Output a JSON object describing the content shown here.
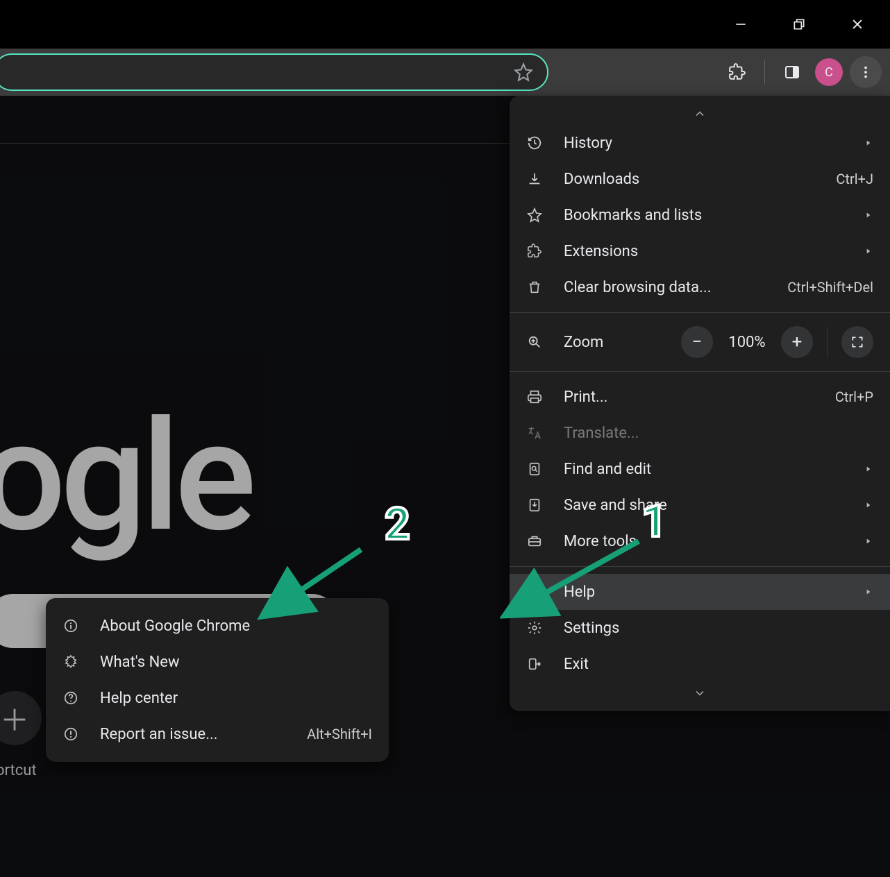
{
  "window_controls": {
    "minimize": "minimize",
    "maximize": "maximize",
    "close": "close"
  },
  "toolbar": {
    "avatar_letter": "C"
  },
  "page": {
    "logo_fragment": "ogle",
    "shortcut_label": "ortcut"
  },
  "menu": {
    "history": "History",
    "downloads": {
      "label": "Downloads",
      "shortcut": "Ctrl+J"
    },
    "bookmarks": "Bookmarks and lists",
    "extensions": "Extensions",
    "clear": {
      "label": "Clear browsing data...",
      "shortcut": "Ctrl+Shift+Del"
    },
    "zoom": {
      "label": "Zoom",
      "value": "100%"
    },
    "print": {
      "label": "Print...",
      "shortcut": "Ctrl+P"
    },
    "translate": "Translate...",
    "find": "Find and edit",
    "save_share": "Save and share",
    "more_tools": "More tools",
    "help": "Help",
    "settings": "Settings",
    "exit": "Exit"
  },
  "submenu": {
    "about": "About Google Chrome",
    "whats_new": "What's New",
    "help_center": "Help center",
    "report": {
      "label": "Report an issue...",
      "shortcut": "Alt+Shift+I"
    }
  },
  "annotations": {
    "one": "1",
    "two": "2"
  }
}
